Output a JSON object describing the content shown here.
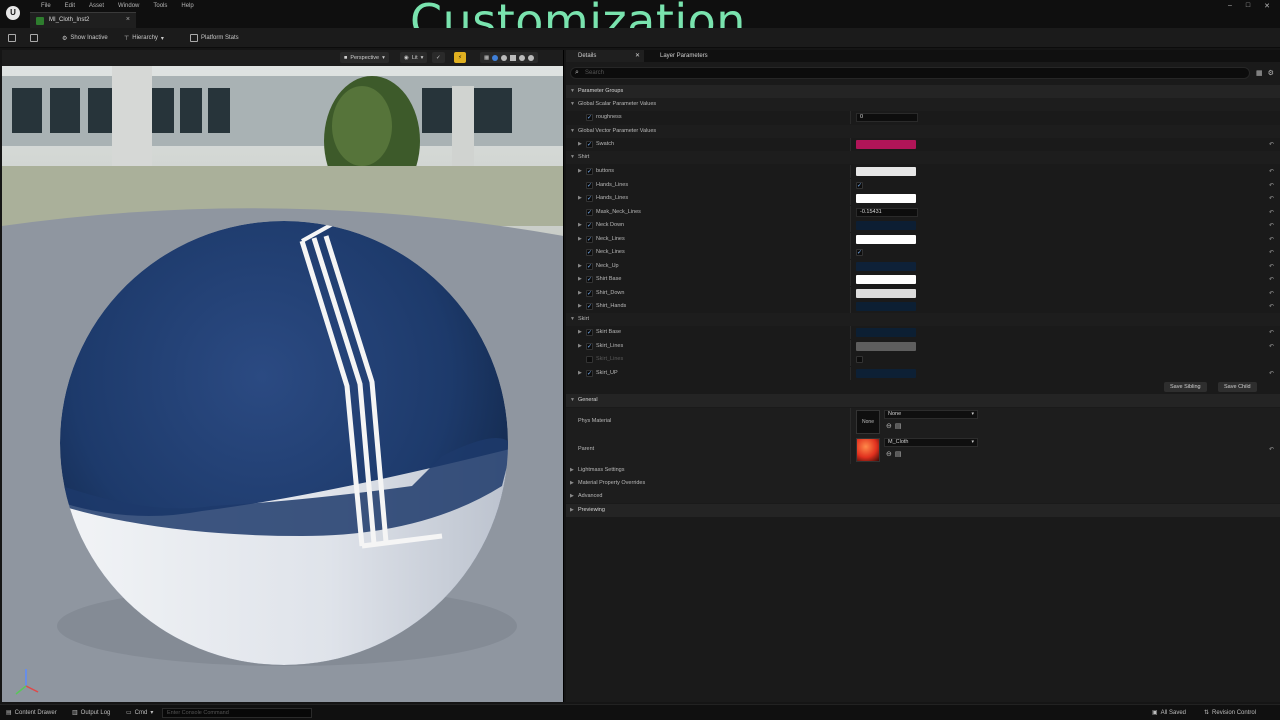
{
  "menu": [
    "File",
    "Edit",
    "Asset",
    "Window",
    "Tools",
    "Help"
  ],
  "tab": {
    "title": "MI_Cloth_Inst2",
    "close": "×"
  },
  "headline": "Customization",
  "window_controls": [
    "–",
    "□",
    "✕"
  ],
  "toolbar": {
    "show_inactive": "Show Inactive",
    "hierarchy": "Hierarchy",
    "platform_stats": "Platform Stats"
  },
  "viewport": {
    "perspective": "Perspective",
    "lit": "Lit"
  },
  "details": {
    "tab_details": "Details",
    "tab_layer": "Layer Parameters",
    "search_placeholder": "Search",
    "parameter_groups": "Parameter Groups",
    "scalar_group": "Global Scalar Parameter Values",
    "roughness": {
      "label": "roughness",
      "value": "0"
    },
    "vector_group": "Global Vector Parameter Values",
    "swatch": {
      "label": "Swatch",
      "color": "#b01558"
    },
    "shirt_group": "Shirt",
    "shirt_params": [
      {
        "label": "buttons",
        "kind": "color",
        "color": "#e6e6e6",
        "checked": true,
        "arrow": true
      },
      {
        "label": "Hands_Lines",
        "kind": "check",
        "checked": true,
        "arrow": false
      },
      {
        "label": "Hands_Lines",
        "kind": "color",
        "color": "#ffffff",
        "checked": true,
        "arrow": true
      },
      {
        "label": "Mask_Neck_Lines",
        "kind": "number",
        "value": "-0.15431",
        "checked": true,
        "arrow": false
      },
      {
        "label": "Neck Down",
        "kind": "color",
        "color": "#0c1e33",
        "checked": true,
        "arrow": true
      },
      {
        "label": "Neck_Lines",
        "kind": "color",
        "color": "#ffffff",
        "checked": true,
        "arrow": true
      },
      {
        "label": "Neck_Lines",
        "kind": "check",
        "checked": true,
        "arrow": false
      },
      {
        "label": "Neck_Up",
        "kind": "color",
        "color": "#0e2138",
        "checked": true,
        "arrow": true
      },
      {
        "label": "Shirt Base",
        "kind": "color",
        "color": "#ffffff",
        "checked": true,
        "arrow": true
      },
      {
        "label": "Shirt_Down",
        "kind": "color",
        "color": "#dcdcdc",
        "checked": true,
        "arrow": true
      },
      {
        "label": "Shirt_Hands",
        "kind": "color",
        "color": "#0c1f33",
        "checked": true,
        "arrow": true
      }
    ],
    "skirt_group": "Skirt",
    "skirt_params": [
      {
        "label": "Skirt Base",
        "kind": "color",
        "color": "#0c1f33",
        "checked": true,
        "arrow": true
      },
      {
        "label": "Skirt_Lines",
        "kind": "color",
        "color": "#5e5e5e",
        "checked": true,
        "arrow": true
      },
      {
        "label": "Skirt_Lines",
        "kind": "check",
        "checked": false,
        "arrow": false
      },
      {
        "label": "Skirt_UP",
        "kind": "color",
        "color": "#0d2035",
        "checked": true,
        "arrow": true
      }
    ],
    "save_sibling": "Save Sibling",
    "save_child": "Save Child",
    "general_group": "General",
    "phys_material": {
      "label": "Phys Material",
      "thumb": "None",
      "value": "None"
    },
    "parent": {
      "label": "Parent",
      "value": "M_Cloth"
    },
    "collapsed": [
      "Lightmass Settings",
      "Material Property Overrides",
      "Advanced",
      "Previewing"
    ]
  },
  "status": {
    "content_drawer": "Content Drawer",
    "output_log": "Output Log",
    "cmd": "Cmd",
    "console_placeholder": "Enter Console Command",
    "all_saved": "All Saved",
    "revision_control": "Revision Control"
  },
  "colors": {
    "accent": "#79e3ae",
    "panel": "#1a1a1a",
    "sphere_blue": "#1d3a6b"
  }
}
